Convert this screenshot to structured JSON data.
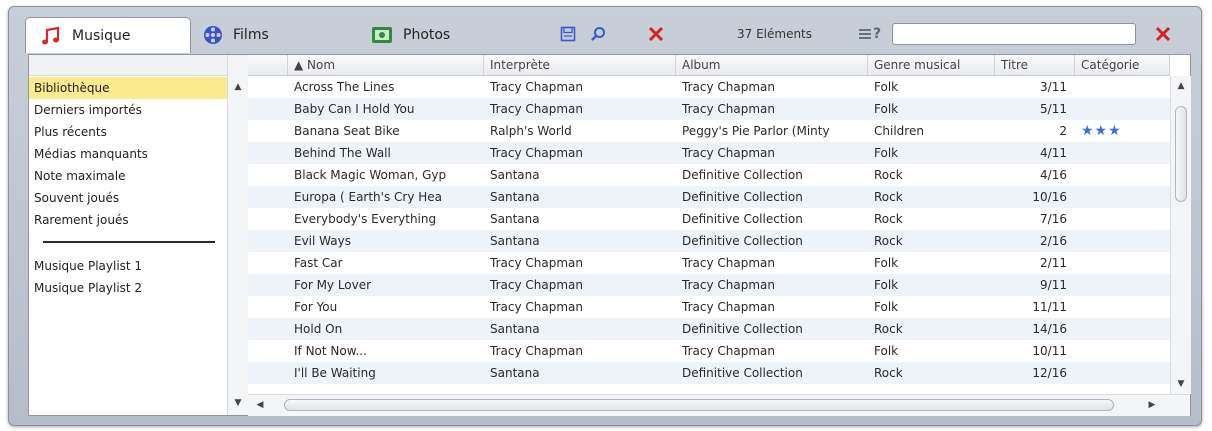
{
  "tabs": {
    "music": "Musique",
    "films": "Films",
    "photos": "Photos"
  },
  "toolbar": {
    "count": "37 Eléments",
    "search_value": "",
    "help_label": "?"
  },
  "sidebar": {
    "items": [
      "Bibliothèque",
      "Derniers importés",
      "Plus récents",
      "Médias manquants",
      "Note maximale",
      "Souvent joués",
      "Rarement joués"
    ],
    "playlists": [
      "Musique Playlist 1",
      "Musique Playlist 2"
    ]
  },
  "table": {
    "columns": [
      "▲ Nom",
      "Interprète",
      "Album",
      "Genre musical",
      "Titre",
      "Catégorie"
    ],
    "rows": [
      {
        "nom": "Across The Lines",
        "interprete": "Tracy Chapman",
        "album": "Tracy Chapman",
        "genre": "Folk",
        "titre": "3/11",
        "categorie": ""
      },
      {
        "nom": "Baby Can I Hold You",
        "interprete": "Tracy Chapman",
        "album": "Tracy Chapman",
        "genre": "Folk",
        "titre": "5/11",
        "categorie": ""
      },
      {
        "nom": "Banana Seat Bike",
        "interprete": "Ralph's World",
        "album": "Peggy's Pie Parlor (Minty",
        "genre": "Children",
        "titre": "2",
        "categorie": "★★★"
      },
      {
        "nom": "Behind The Wall",
        "interprete": "Tracy Chapman",
        "album": "Tracy Chapman",
        "genre": "Folk",
        "titre": "4/11",
        "categorie": ""
      },
      {
        "nom": "Black Magic Woman, Gyp",
        "interprete": "Santana",
        "album": "Definitive Collection",
        "genre": "Rock",
        "titre": "4/16",
        "categorie": ""
      },
      {
        "nom": "Europa ( Earth's Cry Hea",
        "interprete": "Santana",
        "album": "Definitive Collection",
        "genre": "Rock",
        "titre": "10/16",
        "categorie": ""
      },
      {
        "nom": "Everybody's Everything",
        "interprete": "Santana",
        "album": "Definitive Collection",
        "genre": "Rock",
        "titre": "7/16",
        "categorie": ""
      },
      {
        "nom": "Evil Ways",
        "interprete": "Santana",
        "album": "Definitive Collection",
        "genre": "Rock",
        "titre": "2/16",
        "categorie": ""
      },
      {
        "nom": "Fast Car",
        "interprete": "Tracy Chapman",
        "album": "Tracy Chapman",
        "genre": "Folk",
        "titre": "2/11",
        "categorie": ""
      },
      {
        "nom": "For My Lover",
        "interprete": "Tracy Chapman",
        "album": "Tracy Chapman",
        "genre": "Folk",
        "titre": "9/11",
        "categorie": ""
      },
      {
        "nom": "For You",
        "interprete": "Tracy Chapman",
        "album": "Tracy Chapman",
        "genre": "Folk",
        "titre": "11/11",
        "categorie": ""
      },
      {
        "nom": "Hold On",
        "interprete": "Santana",
        "album": "Definitive Collection",
        "genre": "Rock",
        "titre": "14/16",
        "categorie": ""
      },
      {
        "nom": "If Not Now...",
        "interprete": "Tracy Chapman",
        "album": "Tracy Chapman",
        "genre": "Folk",
        "titre": "10/11",
        "categorie": ""
      },
      {
        "nom": "I'll Be Waiting",
        "interprete": "Santana",
        "album": "Definitive Collection",
        "genre": "Rock",
        "titre": "12/16",
        "categorie": ""
      }
    ]
  },
  "colors": {
    "selection": "#fbea8e",
    "row_alt": "#eef2f9",
    "close_red": "#d42222",
    "star_blue": "#3a73d6",
    "music_icon": "#d22a2a"
  },
  "icons": {
    "music": "music-note-icon",
    "films": "film-reel-icon",
    "photos": "photo-icon",
    "save": "save-icon",
    "search": "search-icon",
    "close": "close-icon",
    "list_help": "list-help-icon",
    "clear": "clear-search-icon"
  }
}
